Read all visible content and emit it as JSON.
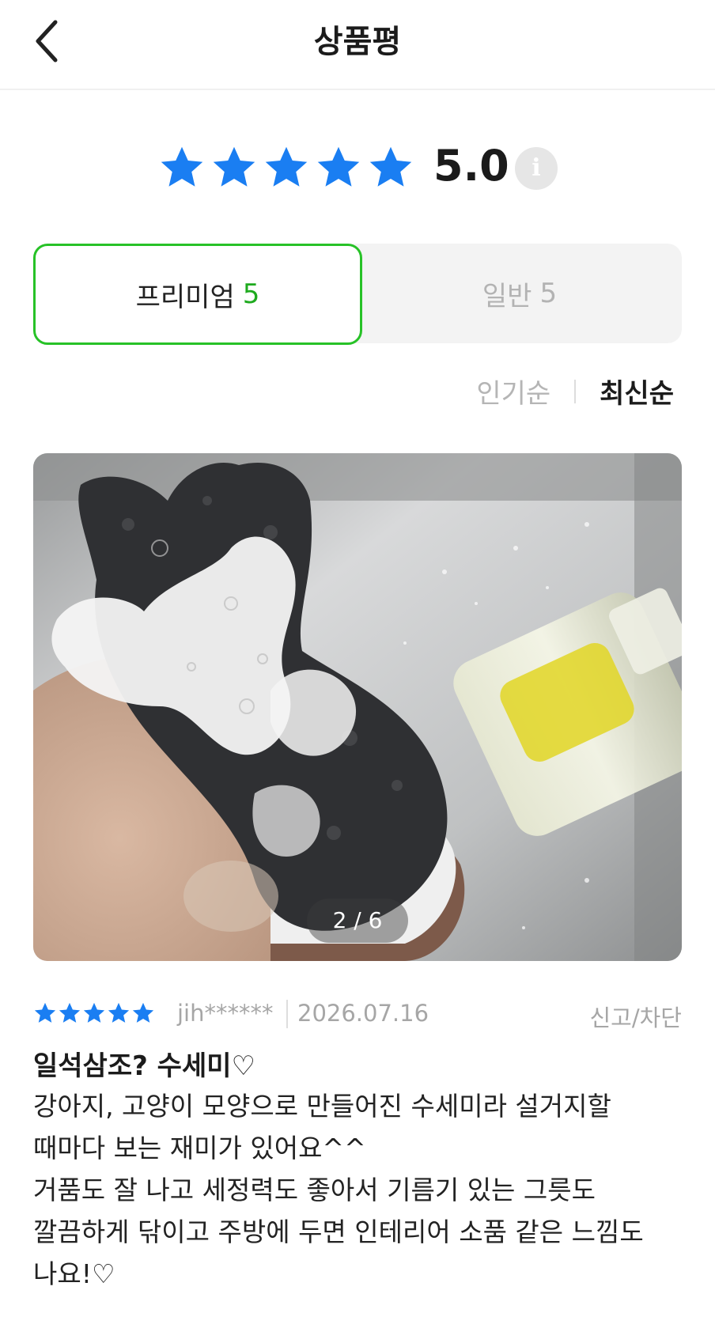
{
  "header": {
    "title": "상품평",
    "back_icon": "chevron-left-icon"
  },
  "rating": {
    "score": "5.0",
    "stars": 5,
    "info_glyph": "i",
    "star_color": "#1a7ef2"
  },
  "tabs": [
    {
      "label": "프리미엄",
      "count": "5",
      "active": true
    },
    {
      "label": "일반",
      "count": "5",
      "active": false
    }
  ],
  "sort": {
    "popular": "인기순",
    "latest": "최신순",
    "selected": "최신순"
  },
  "review": {
    "photo_counter": "2 / 6",
    "rating_stars": 5,
    "user": "jih******",
    "date": "2026.07.16",
    "report": "신고/차단",
    "title": "일석삼조? 수세미♡",
    "body": "강아지, 고양이 모양으로 만들어진 수세미라 설거지할\n때마다 보는 재미가 있어요^^\n거품도 잘 나고 세정력도 좋아서 기름기 있는 그릇도\n깔끔하게 닦이고 주방에 두면 인테리어 소품 같은 느낌도\n나요!♡"
  },
  "colors": {
    "accent_green": "#27c227",
    "count_green": "#1eaa1e",
    "star_blue": "#1a7ef2"
  }
}
